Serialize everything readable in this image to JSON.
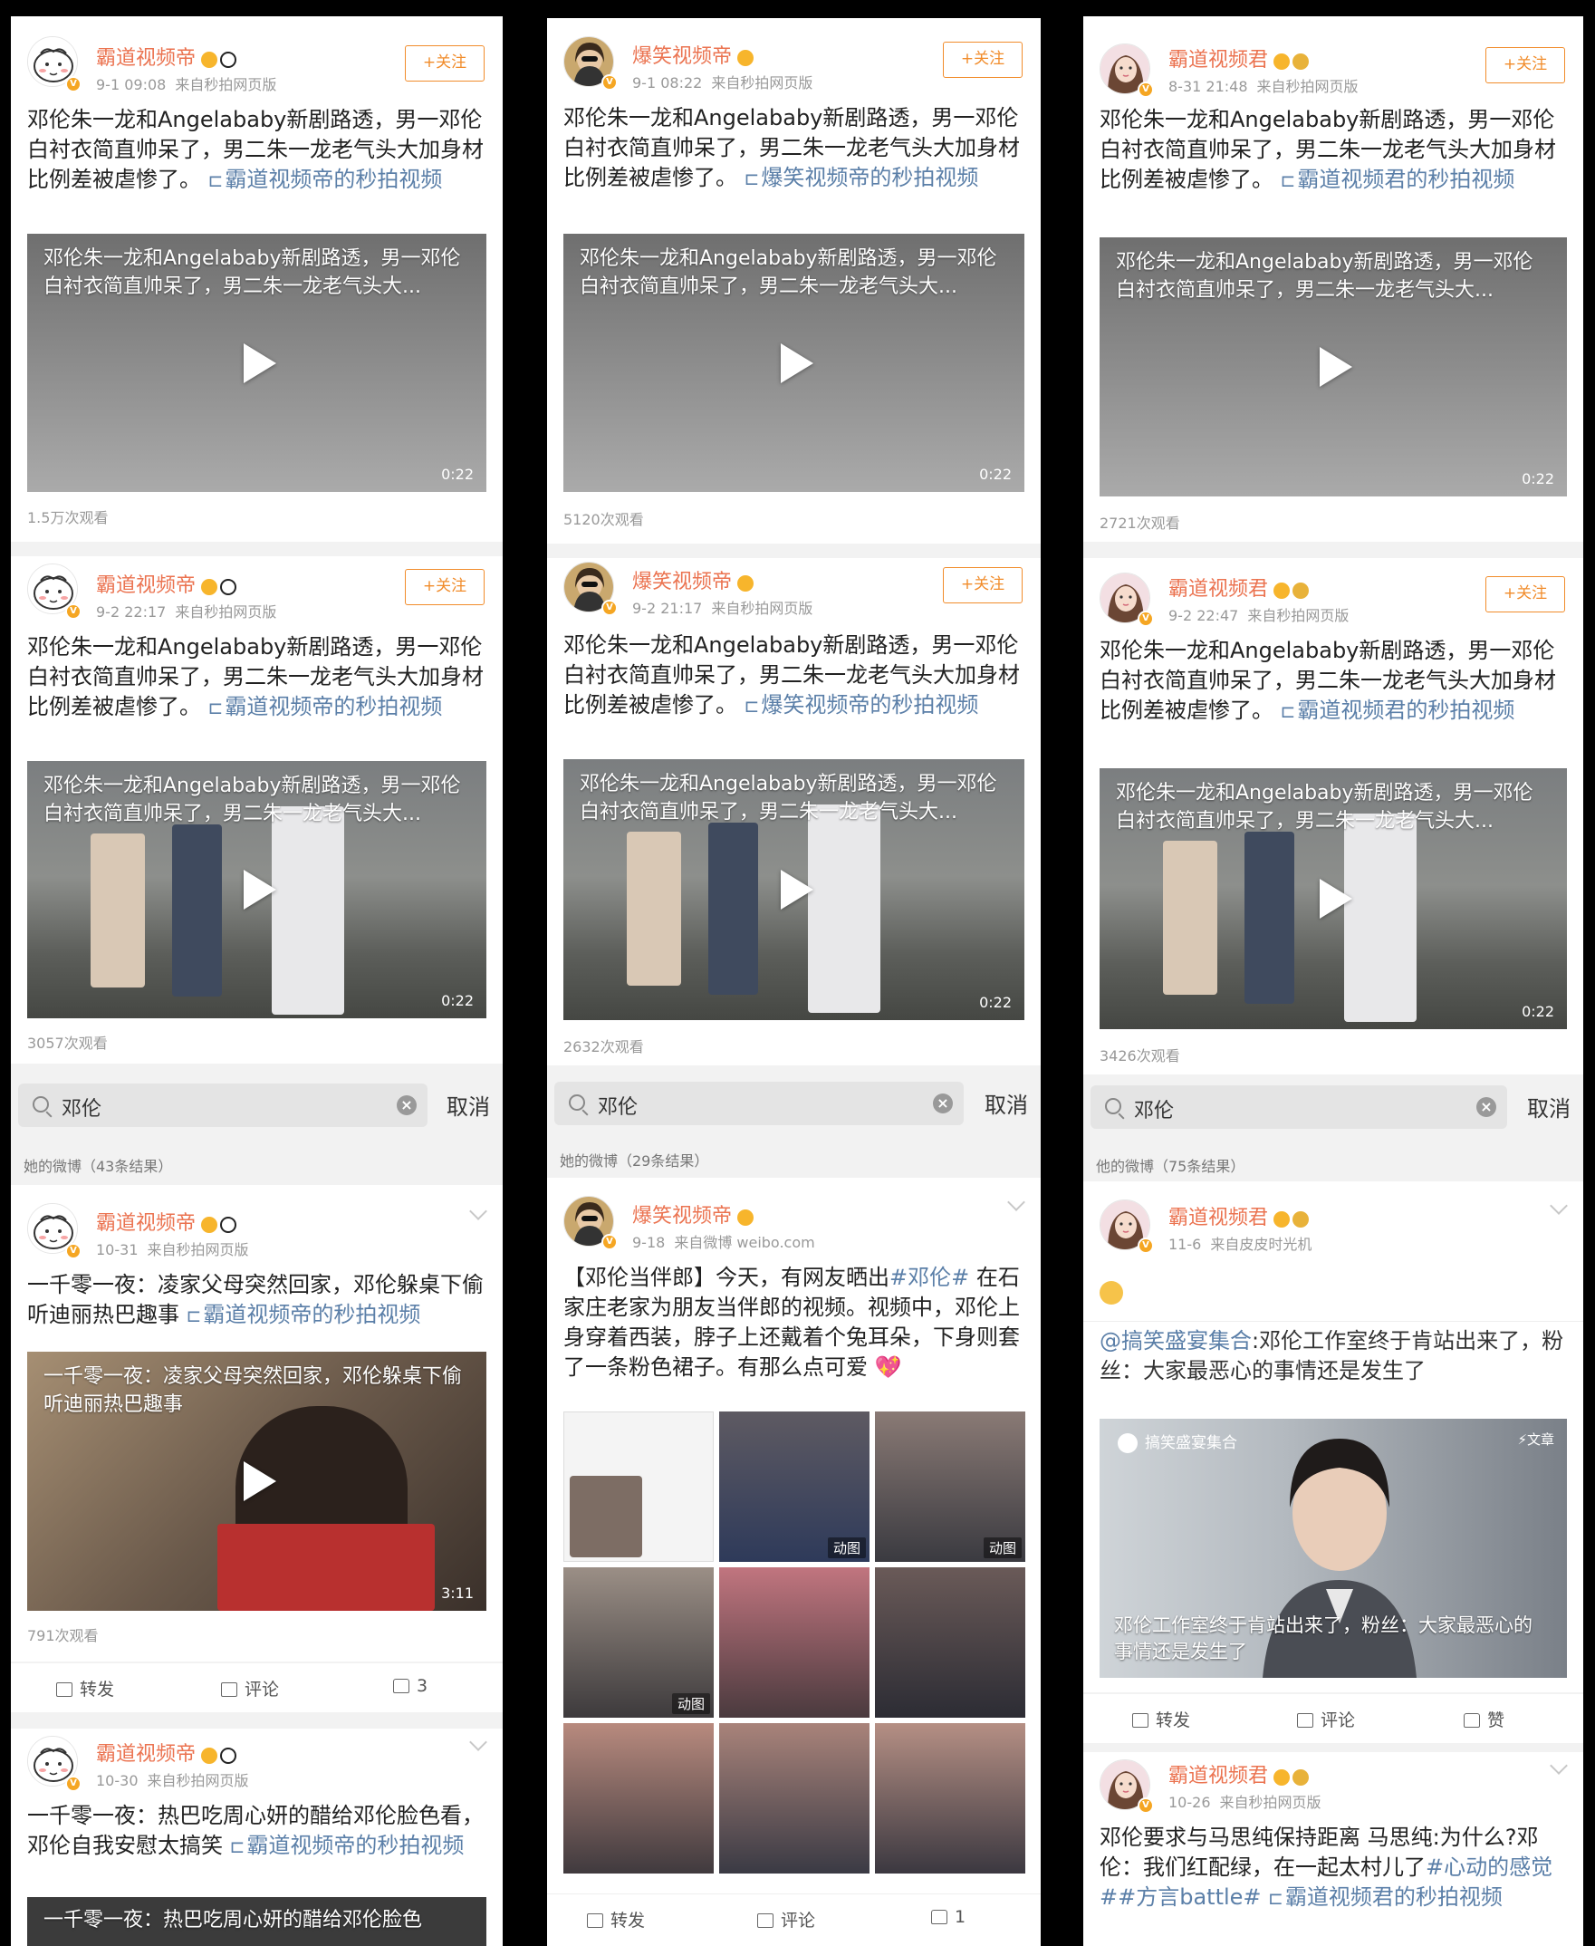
{
  "columns": [
    {
      "posts": [
        {
          "user": "霸道视频帝",
          "date": "9-1 09:08",
          "source": "来自秒拍网页版",
          "follow": "+关注",
          "text": "邓伦朱一龙和Angelababy新剧路透，男一邓伦白衬衣简直帅呆了，男二朱一龙老气头大加身材比例差被虐惨了。",
          "link": "霸道视频帝的秒拍视频",
          "video_title": "邓伦朱一龙和Angelababy新剧路透，男一邓伦白衬衣简直帅呆了，男二朱一龙老气头大...",
          "duration": "0:22",
          "views": "1.5万次观看"
        },
        {
          "user": "霸道视频帝",
          "date": "9-2 22:17",
          "source": "来自秒拍网页版",
          "follow": "+关注",
          "text": "邓伦朱一龙和Angelababy新剧路透，男一邓伦白衬衣简直帅呆了，男二朱一龙老气头大加身材比例差被虐惨了。",
          "link": "霸道视频帝的秒拍视频",
          "video_title": "邓伦朱一龙和Angelababy新剧路透，男一邓伦白衬衣简直帅呆了，男二朱一龙老气头大...",
          "duration": "0:22",
          "views": "3057次观看"
        }
      ],
      "search": {
        "query": "邓伦",
        "cancel": "取消",
        "results": "她的微博（43条结果）"
      },
      "results": [
        {
          "user": "霸道视频帝",
          "date": "10-31",
          "source": "来自秒拍网页版",
          "text": "一千零一夜：凌家父母突然回家，邓伦躲桌下偷听迪丽热巴趣事",
          "link": "霸道视频帝的秒拍视频",
          "video_title": "一千零一夜：凌家父母突然回家，邓伦躲桌下偷听迪丽热巴趣事",
          "duration": "3:11",
          "views": "791次观看",
          "repost": "转发",
          "comment": "评论",
          "like": "3"
        },
        {
          "user": "霸道视频帝",
          "date": "10-30",
          "source": "来自秒拍网页版",
          "text": "一千零一夜：热巴吃周心妍的醋给邓伦脸色看，邓伦自我安慰太搞笑",
          "link": "霸道视频帝的秒拍视频",
          "video_title": "一千零一夜：热巴吃周心妍的醋给邓伦脸色"
        }
      ]
    },
    {
      "posts": [
        {
          "user": "爆笑视频帝",
          "date": "9-1 08:22",
          "source": "来自秒拍网页版",
          "follow": "+关注",
          "text": "邓伦朱一龙和Angelababy新剧路透，男一邓伦白衬衣简直帅呆了，男二朱一龙老气头大加身材比例差被虐惨了。",
          "link": "爆笑视频帝的秒拍视频",
          "video_title": "邓伦朱一龙和Angelababy新剧路透，男一邓伦白衬衣简直帅呆了，男二朱一龙老气头大...",
          "duration": "0:22",
          "views": "5120次观看"
        },
        {
          "user": "爆笑视频帝",
          "date": "9-2 21:17",
          "source": "来自秒拍网页版",
          "follow": "+关注",
          "text": "邓伦朱一龙和Angelababy新剧路透，男一邓伦白衬衣简直帅呆了，男二朱一龙老气头大加身材比例差被虐惨了。",
          "link": "爆笑视频帝的秒拍视频",
          "video_title": "邓伦朱一龙和Angelababy新剧路透，男一邓伦白衬衣简直帅呆了，男二朱一龙老气头大...",
          "duration": "0:22",
          "views": "2632次观看"
        }
      ],
      "search": {
        "query": "邓伦",
        "cancel": "取消",
        "results": "她的微博（29条结果）"
      },
      "results": [
        {
          "user": "爆笑视频帝",
          "date": "9-18",
          "source": "来自微博 weibo.com",
          "text_a": "【邓伦当伴郎】今天，有网友晒出",
          "hashtag": "#邓伦#",
          "text_b": "在石家庄老家为朋友当伴郎的视频。视频中，邓伦上身穿着西装，脖子上还戴着个兔耳朵，下身则套了一条粉色裙子。有那么点可爱",
          "grid_tags": [
            "动图",
            "动图",
            "动图"
          ],
          "repost": "转发",
          "comment": "评论",
          "like": "1"
        }
      ]
    },
    {
      "posts": [
        {
          "user": "霸道视频君",
          "date": "8-31 21:48",
          "source": "来自秒拍网页版",
          "follow": "+关注",
          "text": "邓伦朱一龙和Angelababy新剧路透，男一邓伦白衬衣简直帅呆了，男二朱一龙老气头大加身材比例差被虐惨了。",
          "link": "霸道视频君的秒拍视频",
          "video_title": "邓伦朱一龙和Angelababy新剧路透，男一邓伦白衬衣简直帅呆了，男二朱一龙老气头大...",
          "duration": "0:22",
          "views": "2721次观看"
        },
        {
          "user": "霸道视频君",
          "date": "9-2 22:47",
          "source": "来自秒拍网页版",
          "follow": "+关注",
          "text": "邓伦朱一龙和Angelababy新剧路透，男一邓伦白衬衣简直帅呆了，男二朱一龙老气头大加身材比例差被虐惨了。",
          "link": "霸道视频君的秒拍视频",
          "video_title": "邓伦朱一龙和Angelababy新剧路透，男一邓伦白衬衣简直帅呆了，男二朱一龙老气头大...",
          "duration": "0:22",
          "views": "3426次观看"
        }
      ],
      "search": {
        "query": "邓伦",
        "cancel": "取消",
        "results": "他的微博（75条结果）"
      },
      "results": [
        {
          "user": "霸道视频君",
          "date": "11-6",
          "source": "来自皮皮时光机",
          "mention": "@搞笑盛宴集合",
          "text": ":邓伦工作室终于肯站出来了，粉丝：大家最恶心的事情还是发生了",
          "article_source": "搞笑盛宴集合",
          "article_tag": "⚡文章",
          "article_title": "邓伦工作室终于肯站出来了，粉丝：大家最恶心的事情还是发生了",
          "repost": "转发",
          "comment": "评论",
          "like": "赞"
        },
        {
          "user": "霸道视频君",
          "date": "10-26",
          "source": "来自秒拍网页版",
          "text": "邓伦要求与马思纯保持距离 马思纯:为什么?邓伦：我们红配绿，在一起太村儿了",
          "hashtags": "#心动的感觉##方言battle#",
          "link": "霸道视频君的秒拍视频"
        }
      ]
    }
  ],
  "colors": {
    "username": "#eb7350",
    "link": "#5b7fa8",
    "follow": "#f18c2b",
    "badge": "#f5a623"
  }
}
